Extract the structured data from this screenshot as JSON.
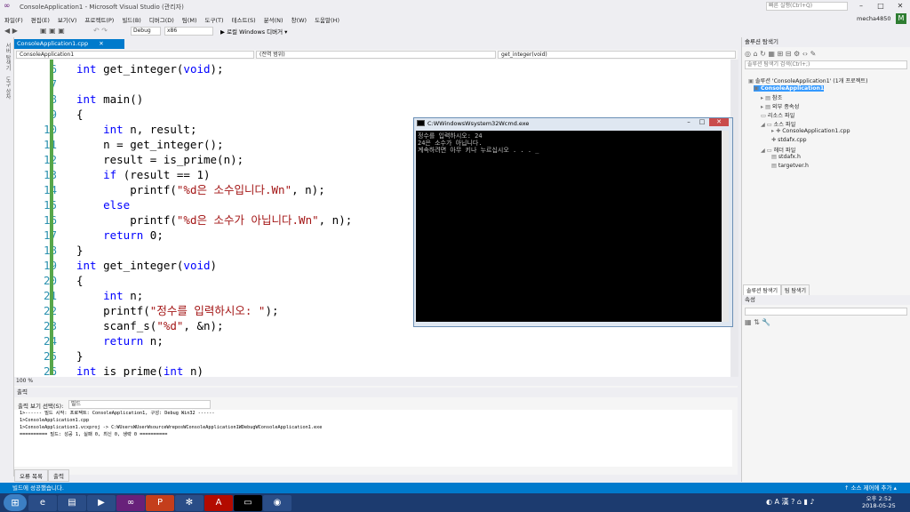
{
  "titlebar": {
    "title": "ConsoleApplication1 - Microsoft Visual Studio (관리자)",
    "quicklaunch": "빠른 실행(Ctrl+Q)",
    "user": "mecha4850"
  },
  "menu": [
    "파일(F)",
    "편집(E)",
    "보기(V)",
    "프로젝트(P)",
    "빌드(B)",
    "디버그(D)",
    "팀(M)",
    "도구(T)",
    "테스트(S)",
    "분석(N)",
    "창(W)",
    "도움말(H)"
  ],
  "toolbar": {
    "config": "Debug",
    "platform": "x86",
    "run": "▶ 로컬 Windows 디버거 ▾"
  },
  "sidebar": {
    "tabs": [
      "서버 탐색기",
      "도구 상자"
    ]
  },
  "editor": {
    "tab": "ConsoleApplication1.cpp",
    "nav": [
      "ConsoleApplication1",
      "(전역 범위)",
      "get_integer(void)"
    ],
    "zoom": "100 %",
    "lines": [
      {
        "n": "6",
        "t": [
          {
            "k": "int"
          },
          {
            "p": " get_integer("
          },
          {
            "k": "void"
          },
          {
            "p": ");"
          }
        ]
      },
      {
        "n": "7",
        "t": []
      },
      {
        "n": "8",
        "t": [
          {
            "k": "int"
          },
          {
            "p": " main()"
          }
        ]
      },
      {
        "n": "9",
        "t": [
          {
            "p": "{"
          }
        ]
      },
      {
        "n": "10",
        "t": [
          {
            "p": "    "
          },
          {
            "k": "int"
          },
          {
            "p": " n, result;"
          }
        ]
      },
      {
        "n": "11",
        "t": [
          {
            "p": "    n = get_integer();"
          }
        ]
      },
      {
        "n": "12",
        "t": [
          {
            "p": "    result = is_prime(n);"
          }
        ]
      },
      {
        "n": "13",
        "t": [
          {
            "p": "    "
          },
          {
            "k": "if"
          },
          {
            "p": " (result == 1)"
          }
        ]
      },
      {
        "n": "14",
        "t": [
          {
            "p": "        printf("
          },
          {
            "s": "\"%d은 소수입니다.Wn\""
          },
          {
            "p": ", n);"
          }
        ]
      },
      {
        "n": "15",
        "t": [
          {
            "p": "    "
          },
          {
            "k": "else"
          }
        ]
      },
      {
        "n": "16",
        "t": [
          {
            "p": "        printf("
          },
          {
            "s": "\"%d은 소수가 아닙니다.Wn\""
          },
          {
            "p": ", n);"
          }
        ]
      },
      {
        "n": "17",
        "t": [
          {
            "p": "    "
          },
          {
            "k": "return"
          },
          {
            "p": " 0;"
          }
        ]
      },
      {
        "n": "18",
        "t": [
          {
            "p": "}"
          }
        ]
      },
      {
        "n": "19",
        "t": [
          {
            "k": "int"
          },
          {
            "p": " get_integer("
          },
          {
            "k": "void"
          },
          {
            "p": ")"
          }
        ]
      },
      {
        "n": "20",
        "t": [
          {
            "p": "{"
          }
        ]
      },
      {
        "n": "21",
        "t": [
          {
            "p": "    "
          },
          {
            "k": "int"
          },
          {
            "p": " n;"
          }
        ]
      },
      {
        "n": "22",
        "t": [
          {
            "p": "    printf("
          },
          {
            "s": "\"정수를 입력하시오: \""
          },
          {
            "p": ");"
          }
        ]
      },
      {
        "n": "23",
        "t": [
          {
            "p": "    scanf_s("
          },
          {
            "s": "\"%d\""
          },
          {
            "p": ", &n);"
          }
        ]
      },
      {
        "n": "24",
        "t": [
          {
            "p": "    "
          },
          {
            "k": "return"
          },
          {
            "p": " n;"
          }
        ]
      },
      {
        "n": "25",
        "t": [
          {
            "p": "}"
          }
        ]
      },
      {
        "n": "26",
        "t": [
          {
            "k": "int"
          },
          {
            "p": " is_prime("
          },
          {
            "k": "int"
          },
          {
            "p": " n)"
          }
        ]
      }
    ]
  },
  "output": {
    "title": "출력",
    "source_label": "출력 보기 선택(S):",
    "source": "빌드",
    "text": "1>------ 빌드 시작: 프로젝트: ConsoleApplication1, 구성: Debug Win32 ------\n1>ConsoleApplication1.cpp\n1>ConsoleApplication1.vcxproj -> C:WUsersWUserWsourceWreposWConsoleApplication1WDebugWConsoleApplication1.exe\n========== 빌드: 성공 1, 실패 0, 최신 0, 생략 0 ==========",
    "tabs": [
      "오류 목록",
      "출력"
    ]
  },
  "solution": {
    "title": "솔루션 탐색기",
    "search": "솔루션 탐색기 검색(Ctrl+;)",
    "items": [
      "솔루션 'ConsoleApplication1' (1개 프로젝트)",
      "ConsoleApplication1",
      "참조",
      "외부 종속성",
      "리소스 파일",
      "소스 파일",
      "ConsoleApplication1.cpp",
      "stdafx.cpp",
      "헤더 파일",
      "stdafx.h",
      "targetver.h"
    ],
    "tabs": [
      "솔루션 탐색기",
      "팀 탐색기"
    ]
  },
  "properties": {
    "title": "속성"
  },
  "cmd": {
    "title": "C:WWindowsWsystem32Wcmd.exe",
    "text": "정수를 입력하시오: 24\n24은 소수가 아닙니다.\n계속하려면 아무 키나 누르십시오 . . . _"
  },
  "status": {
    "left": "빌드에 성공했습니다.",
    "right": "↑ 소스 제어에 추가 ▴"
  },
  "clock": {
    "time": "오후 2:52",
    "date": "2018-05-25"
  }
}
